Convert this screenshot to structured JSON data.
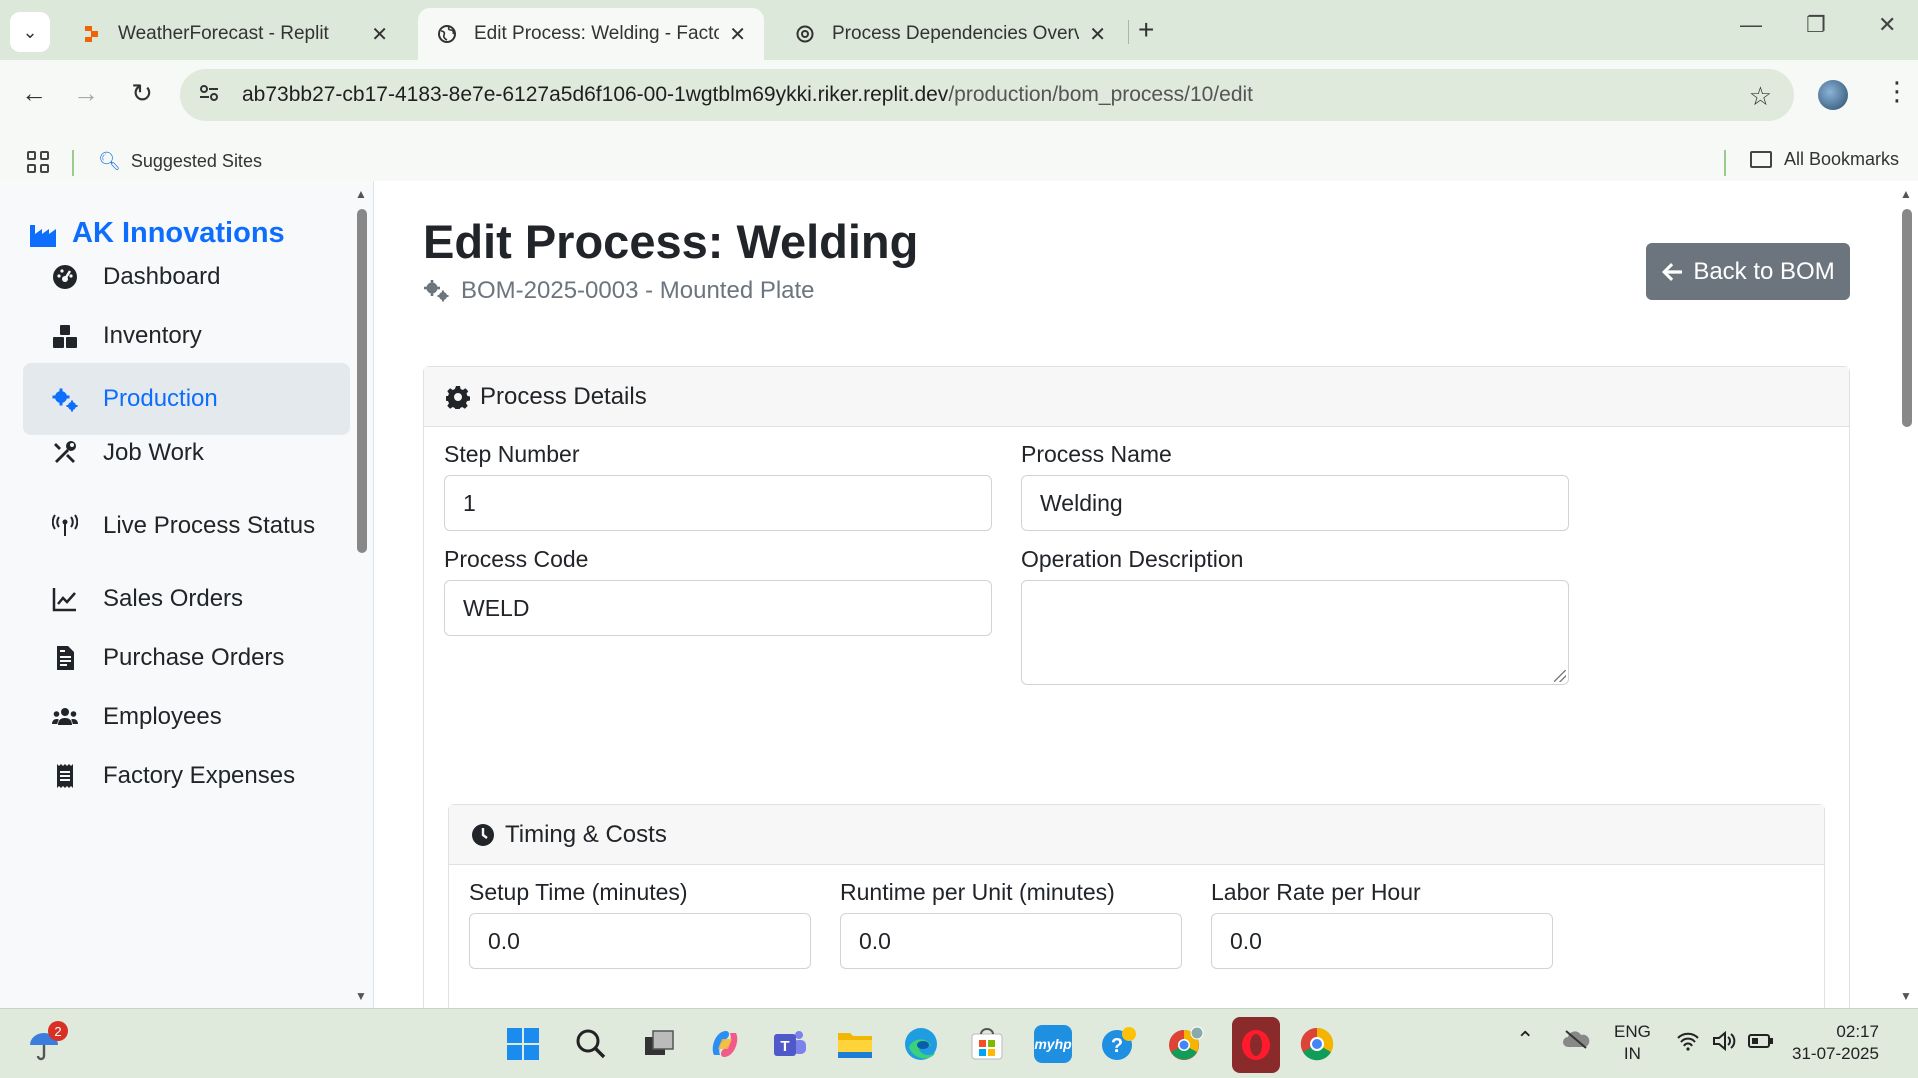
{
  "browser": {
    "tabs": [
      {
        "title": "WeatherForecast - Replit",
        "active": false
      },
      {
        "title": "Edit Process: Welding - Factory",
        "active": true
      },
      {
        "title": "Process Dependencies Overview",
        "active": false
      }
    ],
    "url_host": "ab73bb27-cb17-4183-8e7e-6127a5d6f106-00-1wgtblm69ykki.riker.replit.dev",
    "url_path": "/production/bom_process/10/edit",
    "bookmarks": {
      "suggested": "Suggested Sites",
      "all": "All Bookmarks"
    }
  },
  "sidebar": {
    "brand": "AK Innovations",
    "items": [
      {
        "label": "Dashboard",
        "icon": "gauge-icon"
      },
      {
        "label": "Inventory",
        "icon": "boxes-icon"
      },
      {
        "label": "Production",
        "icon": "cogs-icon",
        "active": true
      },
      {
        "label": "Job Work",
        "icon": "tools-icon"
      },
      {
        "label": "Live Process Status",
        "icon": "broadcast-icon"
      },
      {
        "label": "Sales Orders",
        "icon": "chart-line-icon"
      },
      {
        "label": "Purchase Orders",
        "icon": "file-invoice-icon"
      },
      {
        "label": "Employees",
        "icon": "users-icon"
      },
      {
        "label": "Factory Expenses",
        "icon": "receipt-icon"
      }
    ]
  },
  "page": {
    "title": "Edit Process: Welding",
    "subtitle": "BOM-2025-0003 - Mounted Plate",
    "back_button": "Back to BOM"
  },
  "process_details": {
    "header": "Process Details",
    "step_number_label": "Step Number",
    "step_number": "1",
    "process_name_label": "Process Name",
    "process_name": "Welding",
    "process_code_label": "Process Code",
    "process_code": "WELD",
    "operation_description_label": "Operation Description",
    "operation_description": ""
  },
  "timing": {
    "header": "Timing & Costs",
    "setup_time_label": "Setup Time (minutes)",
    "setup_time": "0.0",
    "runtime_label": "Runtime per Unit (minutes)",
    "runtime": "0.0",
    "labor_rate_label": "Labor Rate per Hour",
    "labor_rate": "0.0"
  },
  "taskbar": {
    "notification_count": "2",
    "lang_top": "ENG",
    "lang_bottom": "IN",
    "time": "02:17",
    "date": "31-07-2025"
  },
  "colors": {
    "accent": "#0d6efd",
    "secondary": "#6c757d",
    "chrome": "#dfe9dc"
  }
}
